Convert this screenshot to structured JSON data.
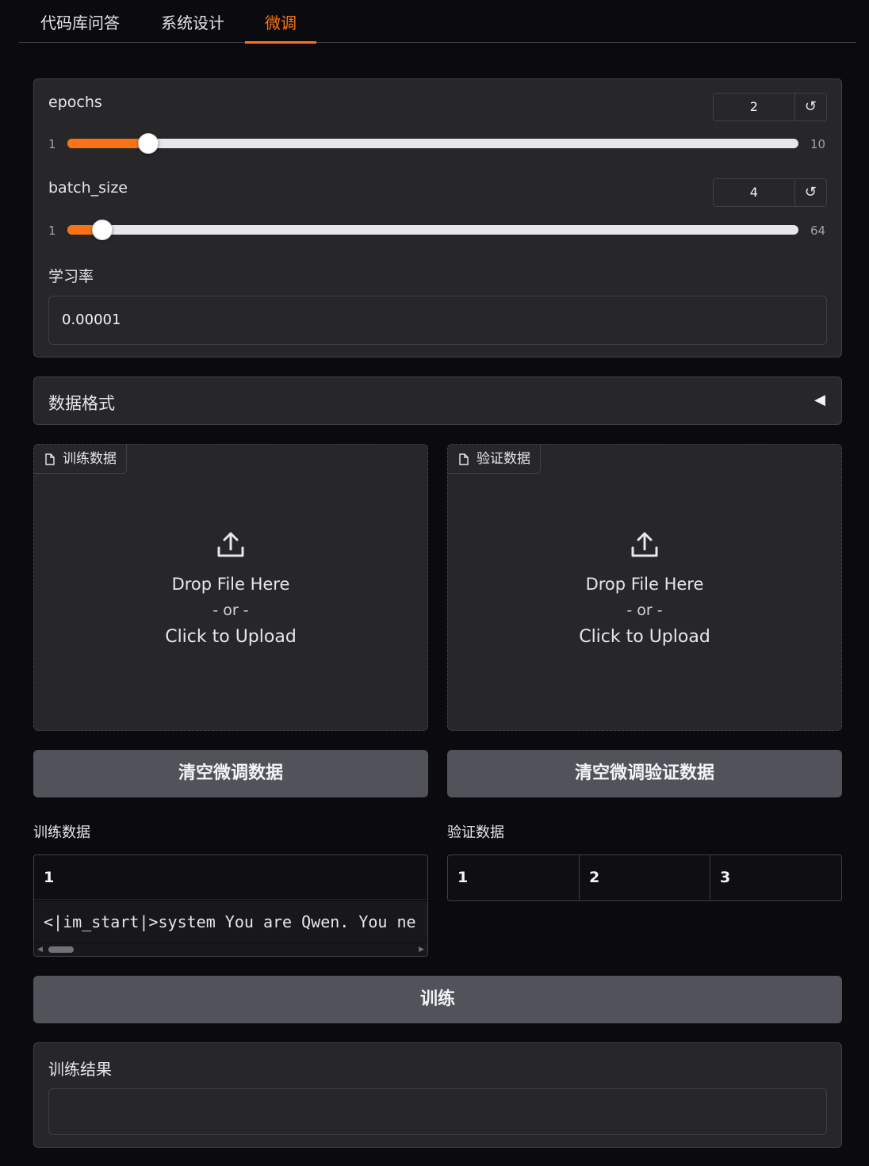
{
  "tabs": [
    {
      "label": "代码库问答"
    },
    {
      "label": "系统设计"
    },
    {
      "label": "微调"
    }
  ],
  "params": {
    "epochs": {
      "label": "epochs",
      "value": "2",
      "min": "1",
      "max": "10",
      "fraction": 0.111
    },
    "batch_size": {
      "label": "batch_size",
      "value": "4",
      "min": "1",
      "max": "64",
      "fraction": 0.048
    },
    "learning_rate": {
      "label": "学习率",
      "value": "0.00001"
    }
  },
  "reset_icon": "↺",
  "data_format": {
    "label": "数据格式",
    "toggle_icon": "◀"
  },
  "uploads": {
    "train": {
      "tag": "训练数据",
      "drop": "Drop File Here",
      "or": "- or -",
      "click": "Click to Upload"
    },
    "validation": {
      "tag": "验证数据",
      "drop": "Drop File Here",
      "or": "- or -",
      "click": "Click to Upload"
    }
  },
  "buttons": {
    "clear_train": "清空微调数据",
    "clear_validation": "清空微调验证数据",
    "train": "训练"
  },
  "train_data": {
    "label": "训练数据",
    "header": "1",
    "row": "<|im_start|>system You are Qwen. You ne"
  },
  "validation_data": {
    "label": "验证数据",
    "headers": [
      "1",
      "2",
      "3"
    ]
  },
  "result": {
    "label": "训练结果",
    "value": ""
  },
  "colors": {
    "accent": "#f97316",
    "panel": "#27272a",
    "background": "#0b0b0f"
  }
}
